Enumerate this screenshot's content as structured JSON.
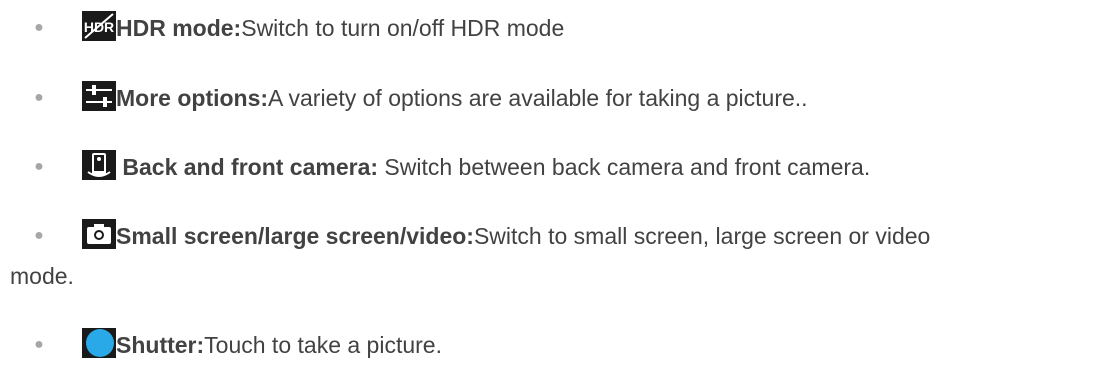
{
  "items": [
    {
      "icon": "hdr-icon",
      "label": "HDR mode:",
      "desc": "Switch to turn on/off HDR mode",
      "desc_cont": ""
    },
    {
      "icon": "sliders-icon",
      "label": "More options:",
      "desc": "A variety of options are available for taking a picture..",
      "desc_cont": ""
    },
    {
      "icon": "camera-switch-icon",
      "label": " Back and front camera:",
      "desc": " Switch between back camera and front camera.",
      "desc_cont": ""
    },
    {
      "icon": "camera-icon",
      "label": "Small screen/large screen/video:",
      "desc": "Switch to small screen, large screen or video",
      "desc_cont": "mode."
    },
    {
      "icon": "shutter-icon",
      "label": "Shutter:",
      "desc": "Touch to take a picture.",
      "desc_cont": ""
    }
  ],
  "colors": {
    "text": "#424242",
    "bullet": "#a6a6a6",
    "shutter": "#29a9e8",
    "icon_dark": "#1a1a1a"
  }
}
